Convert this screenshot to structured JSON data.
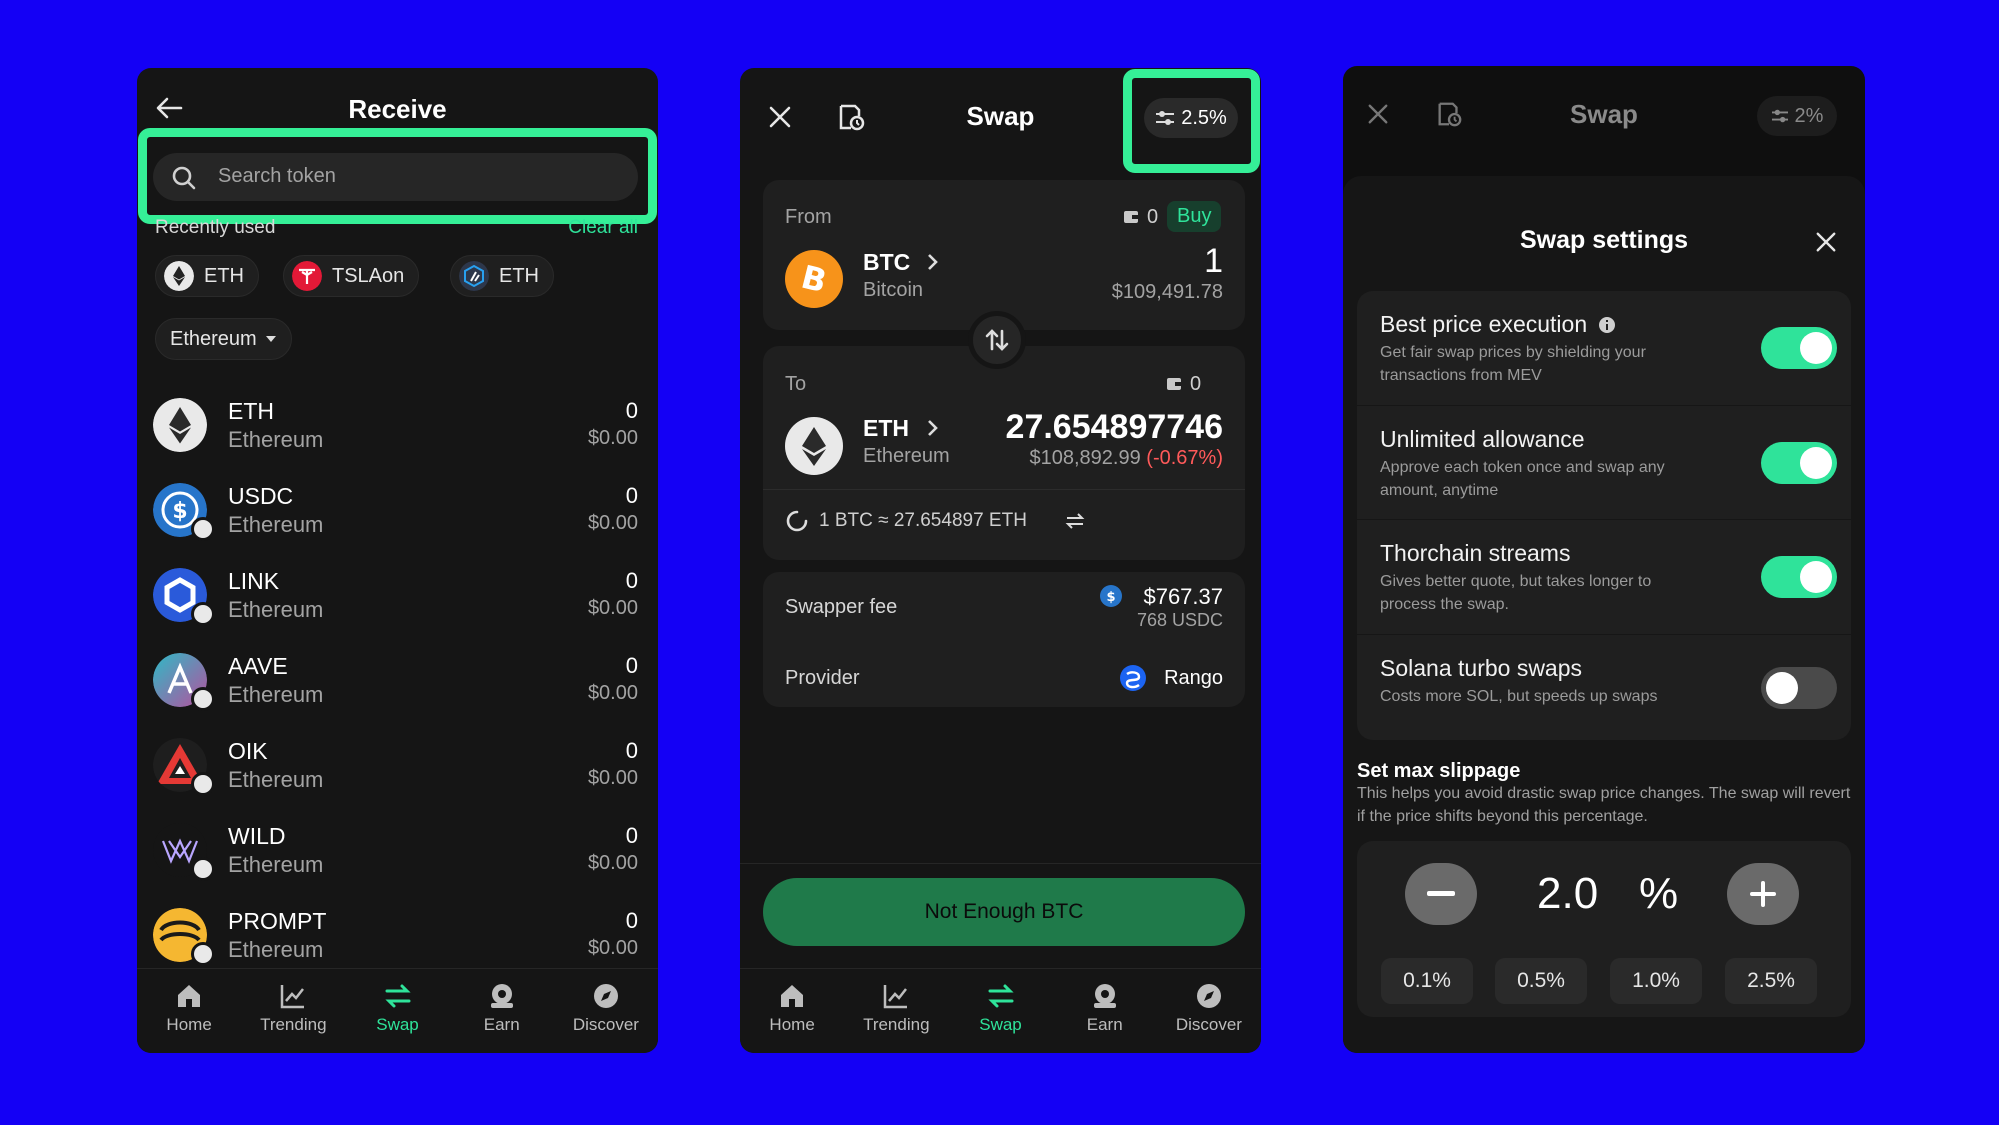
{
  "receive": {
    "title": "Receive",
    "search_placeholder": "Search token",
    "recently_used_label": "Recently used",
    "clear_all": "Clear all",
    "chips": [
      {
        "label": "ETH",
        "icon": "ethereum-icon"
      },
      {
        "label": "TSLAon",
        "icon": "tesla-icon"
      },
      {
        "label": "ETH",
        "icon": "arbitrum-icon"
      }
    ],
    "network_selector": "Ethereum",
    "tokens": [
      {
        "symbol": "ETH",
        "network": "Ethereum",
        "balance": "0",
        "usd": "$0.00",
        "icon": "eth-token-icon"
      },
      {
        "symbol": "USDC",
        "network": "Ethereum",
        "balance": "0",
        "usd": "$0.00",
        "icon": "usdc-token-icon"
      },
      {
        "symbol": "LINK",
        "network": "Ethereum",
        "balance": "0",
        "usd": "$0.00",
        "icon": "link-token-icon"
      },
      {
        "symbol": "AAVE",
        "network": "Ethereum",
        "balance": "0",
        "usd": "$0.00",
        "icon": "aave-token-icon"
      },
      {
        "symbol": "OIK",
        "network": "Ethereum",
        "balance": "0",
        "usd": "$0.00",
        "icon": "oik-token-icon"
      },
      {
        "symbol": "WILD",
        "network": "Ethereum",
        "balance": "0",
        "usd": "$0.00",
        "icon": "wild-token-icon"
      },
      {
        "symbol": "PROMPT",
        "network": "Ethereum",
        "balance": "0",
        "usd": "$0.00",
        "icon": "prompt-token-icon"
      }
    ]
  },
  "nav": {
    "home": "Home",
    "trending": "Trending",
    "swap": "Swap",
    "earn": "Earn",
    "discover": "Discover"
  },
  "swap": {
    "title": "Swap",
    "slippage_badge": "2.5%",
    "from_label": "From",
    "from_balance": "0",
    "buy_label": "Buy",
    "from_symbol": "BTC",
    "from_name": "Bitcoin",
    "from_amount": "1",
    "from_usd": "$109,491.78",
    "to_label": "To",
    "to_balance": "0",
    "to_symbol": "ETH",
    "to_name": "Ethereum",
    "to_amount": "27.654897746",
    "to_usd": "$108,892.99",
    "to_change": "(-0.67%)",
    "rate": "1 BTC ≈ 27.654897 ETH",
    "fee_label": "Swapper fee",
    "fee_usd": "$767.37",
    "fee_token": "768 USDC",
    "provider_label": "Provider",
    "provider_name": "Rango",
    "cta": "Not Enough BTC"
  },
  "settings": {
    "header_title": "Swap",
    "header_badge": "2%",
    "title": "Swap settings",
    "rows": [
      {
        "title": "Best price execution",
        "desc": "Get fair swap prices by shielding your transactions from MEV",
        "on": true
      },
      {
        "title": "Unlimited allowance",
        "desc": "Approve each token once and swap any amount, anytime",
        "on": true
      },
      {
        "title": "Thorchain streams",
        "desc": "Gives better quote, but takes longer to process the swap.",
        "on": true
      },
      {
        "title": "Solana turbo swaps",
        "desc": "Costs more SOL, but speeds up swaps",
        "on": false
      }
    ],
    "slippage_title": "Set max slippage",
    "slippage_desc": "This helps you avoid drastic swap price changes. The swap will revert if the price shifts beyond this percentage.",
    "slippage_value": "2.0",
    "slippage_unit": "%",
    "presets": [
      "0.1%",
      "0.5%",
      "1.0%",
      "2.5%"
    ]
  },
  "colors": {
    "accent": "#2fe39a",
    "background": "#1400f5",
    "panel": "#151515",
    "negative": "#ff5a5a"
  }
}
